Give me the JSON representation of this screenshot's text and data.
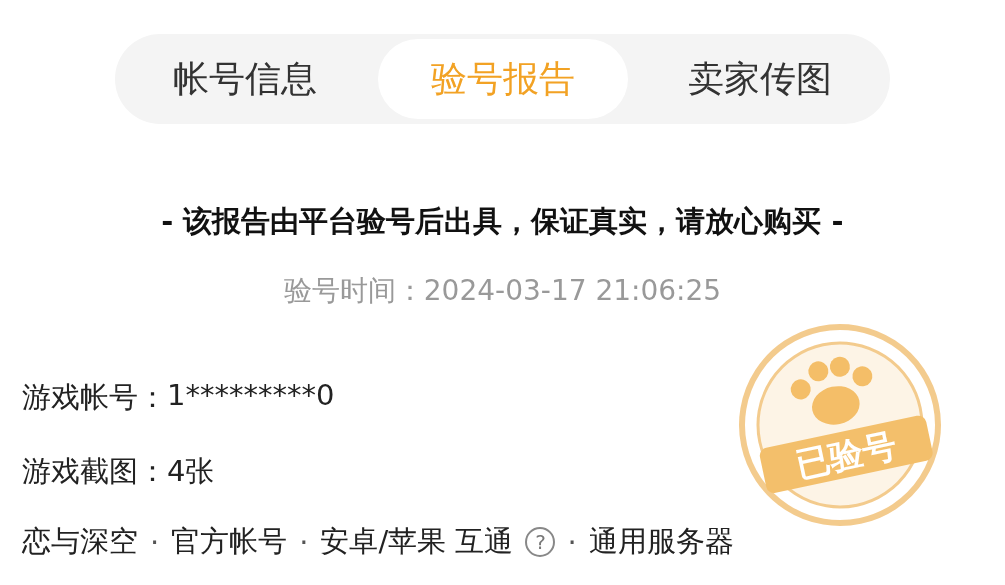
{
  "tabs": [
    {
      "label": "帐号信息",
      "selected": false
    },
    {
      "label": "验号报告",
      "selected": true
    },
    {
      "label": "卖家传图",
      "selected": false
    }
  ],
  "notice": "- 该报告由平台验号后出具，保证真实，请放心购买 -",
  "verify_time": {
    "label": "验号时间：",
    "value": "2024-03-17 21:06:25"
  },
  "fields": [
    {
      "label": "游戏帐号：",
      "value": "1*********0"
    },
    {
      "label": "游戏截图：",
      "value": "4张"
    }
  ],
  "tags": {
    "separator": "·",
    "items": [
      {
        "text": "恋与深空",
        "kind": "plain"
      },
      {
        "text": "官方帐号",
        "kind": "plain"
      },
      {
        "text": "安卓/苹果 互通",
        "kind": "help",
        "icon": "?"
      },
      {
        "text": "通用服务器",
        "kind": "plain"
      }
    ]
  },
  "stamp": {
    "text": "已验号"
  }
}
